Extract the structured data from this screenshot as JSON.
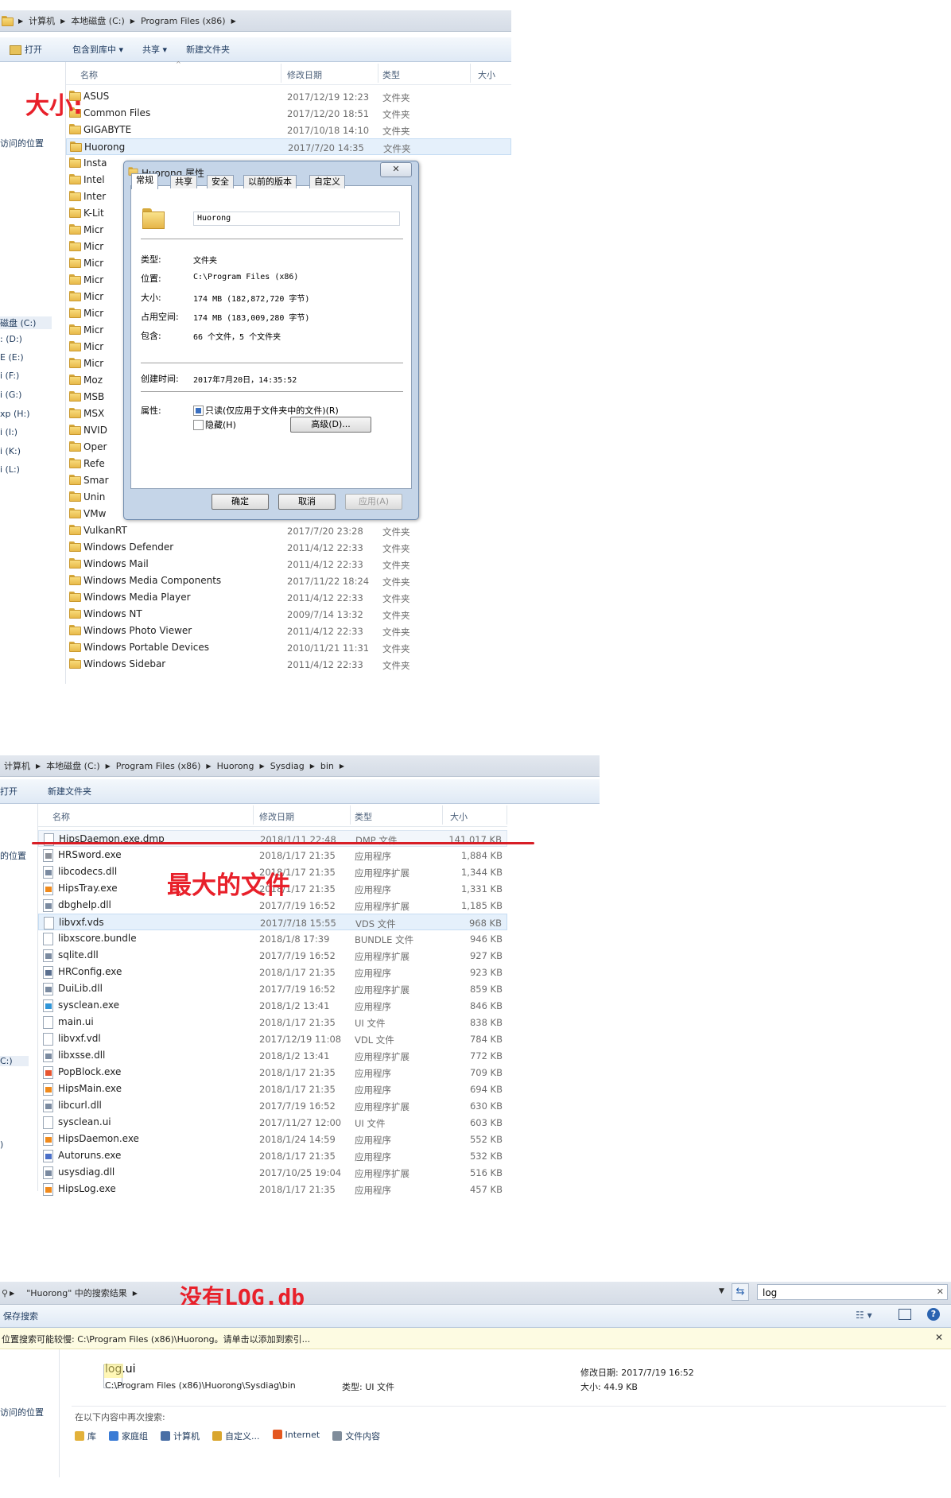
{
  "s1": {
    "address": [
      "计算机",
      "本地磁盘 (C:)",
      "Program Files (x86)"
    ],
    "toolbar": [
      "打开",
      "包含到库中 ▾",
      "共享 ▾",
      "新建文件夹"
    ],
    "nav": [
      "",
      "",
      "",
      "访问的位置",
      "",
      "",
      "",
      "",
      "",
      "",
      "",
      "",
      "",
      "磁盘 (C:)",
      ": (D:)",
      "E (E:)",
      "i (F:)",
      "i (G:)",
      "xp (H:)",
      "i (I:)",
      "i (K:)",
      "i (L:)"
    ],
    "columns": {
      "name": "名称",
      "date": "修改日期",
      "type": "类型",
      "size": "大小"
    },
    "rows": [
      {
        "name": "ASUS",
        "date": "2017/12/19 12:23",
        "type": "文件夹"
      },
      {
        "name": "Common Files",
        "date": "2017/12/20 18:51",
        "type": "文件夹"
      },
      {
        "name": "GIGABYTE",
        "date": "2017/10/18 14:10",
        "type": "文件夹"
      },
      {
        "name": "Huorong",
        "date": "2017/7/20 14:35",
        "type": "文件夹"
      },
      {
        "name": "Insta",
        "date": "",
        "type": ""
      },
      {
        "name": "Intel",
        "date": "",
        "type": ""
      },
      {
        "name": "Inter",
        "date": "",
        "type": ""
      },
      {
        "name": "K-Lit",
        "date": "",
        "type": ""
      },
      {
        "name": "Micr",
        "date": "",
        "type": ""
      },
      {
        "name": "Micr",
        "date": "",
        "type": ""
      },
      {
        "name": "Micr",
        "date": "",
        "type": ""
      },
      {
        "name": "Micr",
        "date": "",
        "type": ""
      },
      {
        "name": "Micr",
        "date": "",
        "type": ""
      },
      {
        "name": "Micr",
        "date": "",
        "type": ""
      },
      {
        "name": "Micr",
        "date": "",
        "type": ""
      },
      {
        "name": "Micr",
        "date": "",
        "type": ""
      },
      {
        "name": "Micr",
        "date": "",
        "type": ""
      },
      {
        "name": "Moz",
        "date": "",
        "type": ""
      },
      {
        "name": "MSB",
        "date": "",
        "type": ""
      },
      {
        "name": "MSX",
        "date": "",
        "type": ""
      },
      {
        "name": "NVID",
        "date": "",
        "type": ""
      },
      {
        "name": "Oper",
        "date": "",
        "type": ""
      },
      {
        "name": "Refe",
        "date": "",
        "type": ""
      },
      {
        "name": "Smar",
        "date": "",
        "type": ""
      },
      {
        "name": "Unin",
        "date": "",
        "type": ""
      },
      {
        "name": "VMw",
        "date": "",
        "type": ""
      },
      {
        "name": "VulkanRT",
        "date": "2017/7/20 23:28",
        "type": "文件夹"
      },
      {
        "name": "Windows Defender",
        "date": "2011/4/12 22:33",
        "type": "文件夹"
      },
      {
        "name": "Windows Mail",
        "date": "2011/4/12 22:33",
        "type": "文件夹"
      },
      {
        "name": "Windows Media Components",
        "date": "2017/11/22 18:24",
        "type": "文件夹"
      },
      {
        "name": "Windows Media Player",
        "date": "2011/4/12 22:33",
        "type": "文件夹"
      },
      {
        "name": "Windows NT",
        "date": "2009/7/14 13:32",
        "type": "文件夹"
      },
      {
        "name": "Windows Photo Viewer",
        "date": "2011/4/12 22:33",
        "type": "文件夹"
      },
      {
        "name": "Windows Portable Devices",
        "date": "2010/11/21 11:31",
        "type": "文件夹"
      },
      {
        "name": "Windows Sidebar",
        "date": "2011/4/12 22:33",
        "type": "文件夹"
      }
    ],
    "annotation": "大小:",
    "dialog": {
      "title": "Huorong 属性",
      "close": "✕",
      "tabs": [
        "常规",
        "共享",
        "安全",
        "以前的版本",
        "自定义"
      ],
      "name_value": "Huorong",
      "fields": [
        {
          "label": "类型:",
          "value": "文件夹"
        },
        {
          "label": "位置:",
          "value": "C:\\Program Files (x86)"
        },
        {
          "label": "大小:",
          "value": "174 MB (182,872,720 字节)"
        },
        {
          "label": "占用空间:",
          "value": "174 MB (183,009,280 字节)"
        },
        {
          "label": "包含:",
          "value": "66 个文件，5 个文件夹"
        }
      ],
      "created_label": "创建时间:",
      "created_value": "2017年7月20日，14:35:52",
      "attr_label": "属性:",
      "readonly_label": "只读(仅应用于文件夹中的文件)(R)",
      "hidden_label": "隐藏(H)",
      "advanced_btn": "高级(D)...",
      "ok": "确定",
      "cancel": "取消",
      "apply": "应用(A)"
    }
  },
  "s2": {
    "address": [
      "计算机",
      "本地磁盘 (C:)",
      "Program Files (x86)",
      "Huorong",
      "Sysdiag",
      "bin"
    ],
    "toolbar": [
      "打开",
      "新建文件夹"
    ],
    "nav": [
      "的位置",
      "C:)",
      ")"
    ],
    "columns": {
      "name": "名称",
      "date": "修改日期",
      "type": "类型",
      "size": "大小"
    },
    "annotation": "最大的文件",
    "rows": [
      {
        "name": "HipsDaemon.exe.dmp",
        "date": "2018/1/11 22:48",
        "type": "DMP 文件",
        "size": "141,017 KB",
        "icon": "file-icon"
      },
      {
        "name": "HRSword.exe",
        "date": "2018/1/17 21:35",
        "type": "应用程序",
        "size": "1,884 KB",
        "icon": "hrsword-icon"
      },
      {
        "name": "libcodecs.dll",
        "date": "2018/1/17 21:35",
        "type": "应用程序扩展",
        "size": "1,344 KB",
        "icon": "dll-icon"
      },
      {
        "name": "HipsTray.exe",
        "date": "2018/1/17 21:35",
        "type": "应用程序",
        "size": "1,331 KB",
        "icon": "huorong-flame-icon"
      },
      {
        "name": "dbghelp.dll",
        "date": "2017/7/19 16:52",
        "type": "应用程序扩展",
        "size": "1,185 KB",
        "icon": "dll-icon"
      },
      {
        "name": "libvxf.vds",
        "date": "2017/7/18 15:55",
        "type": "VDS 文件",
        "size": "968 KB",
        "icon": "file-icon"
      },
      {
        "name": "libxscore.bundle",
        "date": "2018/1/8 17:39",
        "type": "BUNDLE 文件",
        "size": "946 KB",
        "icon": "file-icon"
      },
      {
        "name": "sqlite.dll",
        "date": "2017/7/19 16:52",
        "type": "应用程序扩展",
        "size": "927 KB",
        "icon": "dll-icon"
      },
      {
        "name": "HRConfig.exe",
        "date": "2018/1/17 21:35",
        "type": "应用程序",
        "size": "923 KB",
        "icon": "config-icon"
      },
      {
        "name": "DuiLib.dll",
        "date": "2017/7/19 16:52",
        "type": "应用程序扩展",
        "size": "859 KB",
        "icon": "dll-icon"
      },
      {
        "name": "sysclean.exe",
        "date": "2018/1/2 13:41",
        "type": "应用程序",
        "size": "846 KB",
        "icon": "sysclean-icon"
      },
      {
        "name": "main.ui",
        "date": "2018/1/17 21:35",
        "type": "UI 文件",
        "size": "838 KB",
        "icon": "file-icon"
      },
      {
        "name": "libvxf.vdl",
        "date": "2017/12/19 11:08",
        "type": "VDL 文件",
        "size": "784 KB",
        "icon": "file-icon"
      },
      {
        "name": "libxsse.dll",
        "date": "2018/1/2 13:41",
        "type": "应用程序扩展",
        "size": "772 KB",
        "icon": "dll-icon"
      },
      {
        "name": "PopBlock.exe",
        "date": "2018/1/17 21:35",
        "type": "应用程序",
        "size": "709 KB",
        "icon": "popblock-icon"
      },
      {
        "name": "HipsMain.exe",
        "date": "2018/1/17 21:35",
        "type": "应用程序",
        "size": "694 KB",
        "icon": "huorong-flame-icon"
      },
      {
        "name": "libcurl.dll",
        "date": "2017/7/19 16:52",
        "type": "应用程序扩展",
        "size": "630 KB",
        "icon": "dll-icon"
      },
      {
        "name": "sysclean.ui",
        "date": "2017/11/27 12:00",
        "type": "UI 文件",
        "size": "603 KB",
        "icon": "file-icon"
      },
      {
        "name": "HipsDaemon.exe",
        "date": "2018/1/24 14:59",
        "type": "应用程序",
        "size": "552 KB",
        "icon": "huorong-flame-icon"
      },
      {
        "name": "Autoruns.exe",
        "date": "2018/1/17 21:35",
        "type": "应用程序",
        "size": "532 KB",
        "icon": "autoruns-icon"
      },
      {
        "name": "usysdiag.dll",
        "date": "2017/10/25 19:04",
        "type": "应用程序扩展",
        "size": "516 KB",
        "icon": "dll-icon"
      },
      {
        "name": "HipsLog.exe",
        "date": "2018/1/17 21:35",
        "type": "应用程序",
        "size": "457 KB",
        "icon": "huorong-flame-icon"
      }
    ]
  },
  "s3": {
    "address": [
      "\"Huorong\" 中的搜索结果"
    ],
    "search_value": "log",
    "annotation": "没有LOG.db",
    "toolbar_label": "保存搜索",
    "infobar": "位置搜索可能较慢: C:\\Program Files (x86)\\Huorong。请单击以添加到索引...",
    "nav": [
      "访问的位置"
    ],
    "result": {
      "name": "log.ui",
      "path": "C:\\Program Files (x86)\\Huorong\\Sysdiag\\bin",
      "type_label": "类型: UI 文件",
      "date_label": "修改日期: 2017/7/19 16:52",
      "size_label": "大小: 44.9 KB"
    },
    "search_again_label": "在以下内容中再次搜索:",
    "search_again": [
      "库",
      "家庭组",
      "计算机",
      "自定义...",
      "Internet",
      "文件内容"
    ]
  }
}
